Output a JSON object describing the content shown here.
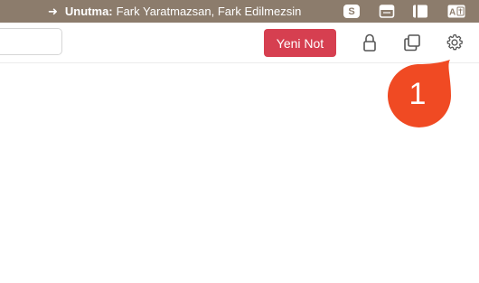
{
  "menubar": {
    "ticker_prefix": "Unutma:",
    "ticker_text": "Fark Yaratmazsan, Fark Edilmezsin",
    "tray": [
      {
        "icon": "skype-icon",
        "label": "S"
      },
      {
        "icon": "window-icon"
      },
      {
        "icon": "notes-icon"
      },
      {
        "icon": "translate-icon",
        "label": "A"
      }
    ]
  },
  "toolbar": {
    "search_value": "",
    "new_note_label": "Yeni Not",
    "icons": [
      "lock-icon",
      "copy-icon",
      "gear-icon"
    ]
  },
  "callout": {
    "number": "1",
    "color": "#f04a23"
  },
  "colors": {
    "menubar_bg": "#8c7c6c",
    "accent": "#d63f50",
    "callout": "#f04a23",
    "icon_stroke": "#555555"
  }
}
